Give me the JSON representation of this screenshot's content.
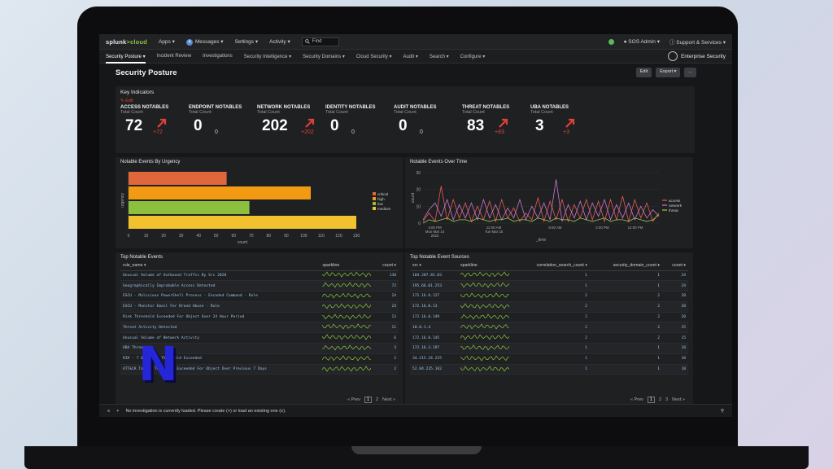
{
  "topbar": {
    "logo_text": "splunk",
    "logo_accent": ">cloud",
    "menus": [
      "Apps ▾",
      "Messages ▾",
      "Settings ▾",
      "Activity ▾"
    ],
    "messages_count": "4",
    "find_placeholder": "Find",
    "user": "SOS Admin ▾",
    "support": "Support & Services ▾"
  },
  "navbar": {
    "items": [
      "Security Posture ▾",
      "Incident Review",
      "Investigations",
      "Security Intelligence ▾",
      "Security Domains ▾",
      "Cloud Security ▾",
      "Audit ▾",
      "Search ▾",
      "Configure ▾"
    ],
    "app_name": "Enterprise Security"
  },
  "page": {
    "title": "Security Posture",
    "edit": "Edit",
    "export": "Export ▾",
    "more": "..."
  },
  "key_indicators": {
    "title": "Key Indicators",
    "edit_link": "✎ Edit",
    "items": [
      {
        "name": "ACCESS NOTABLES",
        "sub": "Total Count",
        "value": "72",
        "delta": "+72",
        "trend": "up"
      },
      {
        "name": "ENDPOINT NOTABLES",
        "sub": "Total Count",
        "value": "0",
        "delta": "0",
        "trend": "none"
      },
      {
        "name": "NETWORK NOTABLES",
        "sub": "Total Count",
        "value": "202",
        "delta": "+202",
        "trend": "up"
      },
      {
        "name": "IDENTITY NOTABLES",
        "sub": "Total Count",
        "value": "0",
        "delta": "0",
        "trend": "none"
      },
      {
        "name": "AUDIT NOTABLES",
        "sub": "Total Count",
        "value": "0",
        "delta": "0",
        "trend": "none"
      },
      {
        "name": "THREAT NOTABLES",
        "sub": "Total Count",
        "value": "83",
        "delta": "+83",
        "trend": "up"
      },
      {
        "name": "UBA NOTABLES",
        "sub": "Total Count",
        "value": "3",
        "delta": "+3",
        "trend": "up"
      }
    ]
  },
  "chart_data": [
    {
      "type": "bar",
      "title": "Notable Events By Urgency",
      "orientation": "horizontal",
      "ylabel": "urgency",
      "xlabel": "count",
      "categories": [
        "critical",
        "high",
        "low",
        "medium"
      ],
      "values": [
        56,
        104,
        69,
        130
      ],
      "colors": [
        "#e0673c",
        "#f29a12",
        "#8bbf3d",
        "#f2c12e"
      ],
      "xlim": [
        0,
        130
      ],
      "xticks": [
        "0",
        "10",
        "20",
        "30",
        "40",
        "50",
        "60",
        "70",
        "80",
        "90",
        "100",
        "110",
        "120",
        "130"
      ],
      "legend": [
        "critical",
        "high",
        "low",
        "medium"
      ],
      "legend_position": "right"
    },
    {
      "type": "line",
      "title": "Notable Events Over Time",
      "ylabel": "count",
      "xlabel": "_time",
      "ylim": [
        0,
        30
      ],
      "yticks": [
        "0",
        "10",
        "20",
        "30"
      ],
      "xticks": [
        "4:00 PM\nMon Mar 14\n2022",
        "12:00 AM\nTue Mar 15",
        "8:00 AM",
        "4:00 PM",
        "12:00 PM"
      ],
      "series": [
        {
          "name": "access",
          "color": "#e85a5a",
          "values": [
            1,
            6,
            1,
            22,
            2,
            14,
            3,
            12,
            1,
            10,
            2,
            13,
            1,
            14,
            3,
            9,
            1,
            6,
            2,
            15,
            1,
            13,
            2,
            14,
            1,
            11,
            3,
            14,
            2,
            13,
            1,
            14,
            2,
            16,
            1,
            14,
            3,
            12,
            1,
            6
          ]
        },
        {
          "name": "network",
          "color": "#c678c9",
          "values": [
            2,
            8,
            12,
            4,
            14,
            2,
            11,
            3,
            12,
            2,
            14,
            3,
            11,
            2,
            9,
            3,
            14,
            2,
            10,
            3,
            12,
            2,
            26,
            1,
            11,
            3,
            13,
            2,
            12,
            4,
            14,
            2,
            11,
            3,
            12,
            2,
            10,
            3,
            8,
            4
          ]
        },
        {
          "name": "threat",
          "color": "#9ccc4a",
          "values": [
            0,
            2,
            1,
            2,
            3,
            1,
            2,
            2,
            1,
            3,
            2,
            1,
            2,
            2,
            3,
            1,
            2,
            2,
            1,
            3,
            2,
            1,
            3,
            2,
            2,
            1,
            3,
            2,
            1,
            2,
            3,
            1,
            2,
            2,
            1,
            3,
            2,
            1,
            2,
            5
          ]
        }
      ],
      "legend": [
        "access",
        "network",
        "threat"
      ],
      "legend_position": "right"
    }
  ],
  "top_notable_events": {
    "title": "Top Notable Events",
    "columns": [
      "rule_name ▾",
      "sparkline",
      "count ▾"
    ],
    "rows": [
      {
        "name": "Unusual Volume of Outbound Traffic By Src 2020",
        "count": "138"
      },
      {
        "name": "Geographically Improbable Access Detected",
        "count": "72"
      },
      {
        "name": "ESCU - Malicious PowerShell Process - Encoded Command - Rule",
        "count": "24"
      },
      {
        "name": "ESCU - Monitor Email For Brand Abuse - Rule",
        "count": "24"
      },
      {
        "name": "Risk Threshold Exceeded For Object Over 24 Hour Period",
        "count": "13"
      },
      {
        "name": "Threat Activity Detected",
        "count": "11"
      },
      {
        "name": "Unusual Volume of Network Activity",
        "count": "6"
      },
      {
        "name": "UBA Threat",
        "count": "3"
      },
      {
        "name": "RIR - 7 Day Risk Threshold Exceeded",
        "count": "2"
      },
      {
        "name": "ATT&CK Tactic Threshold Exceeded For Object Over Previous 7 Days",
        "count": "2"
      }
    ],
    "pager_prev": "« Prev",
    "pages": [
      "1",
      "2"
    ],
    "pager_next": "Next »"
  },
  "top_sources": {
    "title": "Top Notable Event Sources",
    "columns": [
      "src ▾",
      "sparkline",
      "correlation_search_count ▾",
      "security_domain_count ▾",
      "count ▾"
    ],
    "rows": [
      {
        "src": "104.207.83.83",
        "corr": "1",
        "dom": "1",
        "count": "24"
      },
      {
        "src": "195.66.01.253",
        "corr": "1",
        "dom": "1",
        "count": "24"
      },
      {
        "src": "172.16.0.127",
        "corr": "2",
        "dom": "2",
        "count": "20"
      },
      {
        "src": "172.16.0.13",
        "corr": "2",
        "dom": "2",
        "count": "20"
      },
      {
        "src": "172.16.0.149",
        "corr": "2",
        "dom": "2",
        "count": "20"
      },
      {
        "src": "10.0.1.4",
        "corr": "2",
        "dom": "2",
        "count": "15"
      },
      {
        "src": "172.16.0.145",
        "corr": "2",
        "dom": "2",
        "count": "15"
      },
      {
        "src": "172.16.3.197",
        "corr": "1",
        "dom": "1",
        "count": "18"
      },
      {
        "src": "34.215.24.225",
        "corr": "1",
        "dom": "1",
        "count": "18"
      },
      {
        "src": "52.84.235.182",
        "corr": "1",
        "dom": "1",
        "count": "18"
      }
    ],
    "pager_prev": "« Prev",
    "pages": [
      "1",
      "2",
      "3"
    ],
    "pager_next": "Next »"
  },
  "footer": {
    "text": "No investigation is currently loaded. Please create (+) or load an existing one (≡)."
  },
  "overlay": {
    "letter": "N",
    "color": "#2626d9"
  }
}
